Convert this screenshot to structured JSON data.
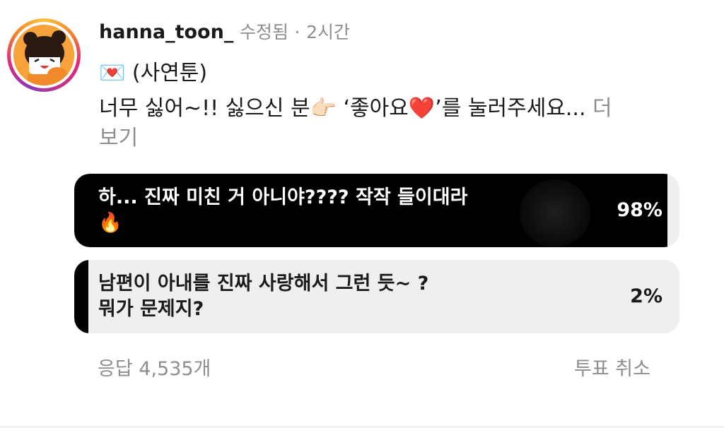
{
  "post": {
    "username": "hanna_toon_",
    "edited_label": "수정됨",
    "separator": "·",
    "time": "2시간",
    "caption_line1_emoji": "💌",
    "caption_line1_text": "(사연툰)",
    "caption_line2_a": "너무 싫어~!! 싫으신 분",
    "caption_line2_emoji_hand": "👉🏻",
    "caption_line2_b": "‘좋아요",
    "caption_line2_emoji_heart": "❤️",
    "caption_line2_c": "’를 눌러주세요...",
    "more_part1": "더",
    "more_part2": "보기"
  },
  "poll": {
    "options": [
      {
        "line1": "하... 진짜 미친 거 아니야???? 작작 들이대라",
        "line2": "🔥",
        "percent_label": "98%",
        "percent": 98
      },
      {
        "line1": "남편이 아내를 진짜 사랑해서 그런 듯~ ?",
        "line2": "뭐가 문제지?",
        "percent_label": "2%",
        "percent": 2
      }
    ],
    "responses_label": "응답 4,535개",
    "cancel_vote_label": "투표 취소"
  },
  "colors": {
    "fill": "#000000",
    "track": "#efefef",
    "muted": "#8e8e8e",
    "heart": "#e0202c"
  },
  "icons": {
    "avatar": "cartoon-girl-avatar",
    "envelope": "love-letter-emoji",
    "hand": "pointing-hand-emoji",
    "heart": "red-heart-emoji",
    "fire": "fire-emoji"
  }
}
